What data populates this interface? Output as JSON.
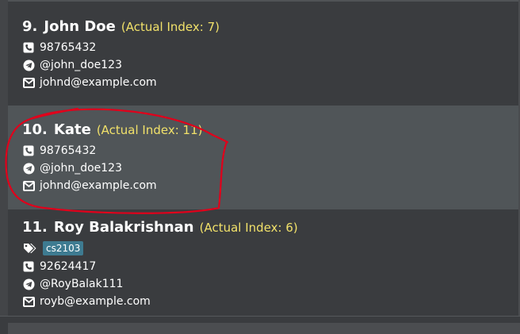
{
  "persons": [
    {
      "number": "9.",
      "name": "John Doe",
      "actual_index": "(Actual Index: 7)",
      "phone": "98765432",
      "telegram": "@john_doe123",
      "email": "johnd@example.com"
    },
    {
      "number": "10.",
      "name": "Kate",
      "actual_index": "(Actual Index: 11)",
      "phone": "98765432",
      "telegram": "@john_doe123",
      "email": "johnd@example.com"
    },
    {
      "number": "11.",
      "name": "Roy Balakrishnan",
      "actual_index": "(Actual Index: 6)",
      "tag": "cs2103",
      "phone": "92624417",
      "telegram": "@RoyBalak111",
      "email": "royb@example.com"
    }
  ],
  "icons": {
    "phone": "phone-icon",
    "telegram": "telegram-icon",
    "email": "email-icon",
    "tag": "tag-icon"
  },
  "colors": {
    "background": "#3c3e41",
    "selected_card": "#505558",
    "index_text": "#f1e16a",
    "tag_bg": "#3e7b91",
    "annotation": "#e0001b"
  }
}
